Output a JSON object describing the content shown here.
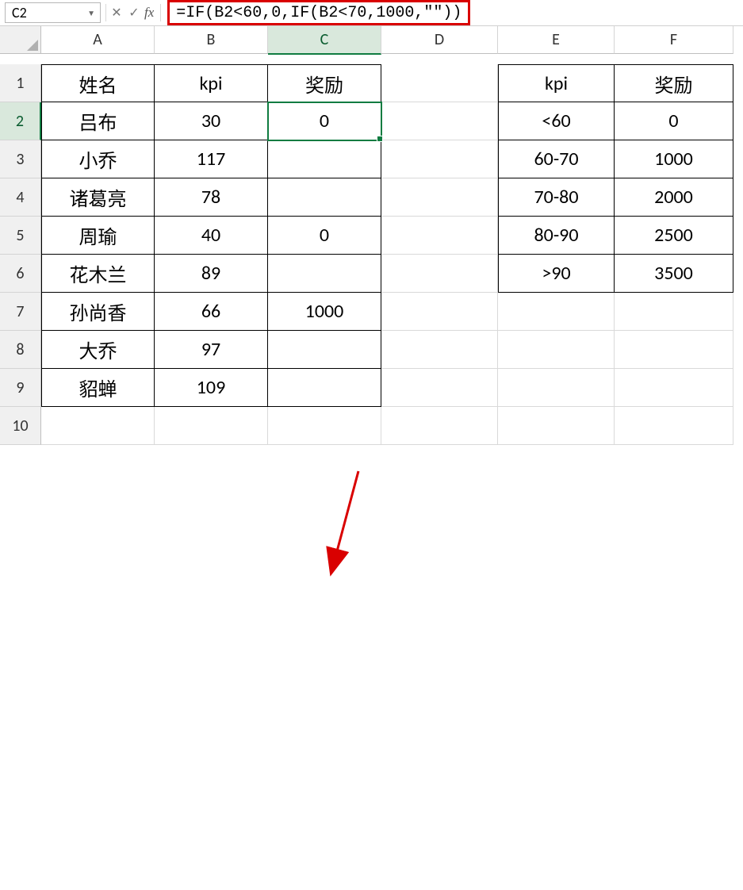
{
  "nameBox": {
    "value": "C2"
  },
  "formulaBar": {
    "cancel": "✕",
    "enter": "✓",
    "fx": "fx",
    "formula": "=IF(B2<60,0,IF(B2<70,1000,\"\"))"
  },
  "colHeaders": [
    "A",
    "B",
    "C",
    "D",
    "E",
    "F"
  ],
  "rowHeaders": [
    "1",
    "2",
    "3",
    "4",
    "5",
    "6",
    "7",
    "8",
    "9",
    "10"
  ],
  "selectedCell": "C2",
  "table_main": {
    "headers": {
      "A": "姓名",
      "B": "kpi",
      "C": "奖励"
    },
    "rows": [
      {
        "A": "吕布",
        "B": "30",
        "C": "0"
      },
      {
        "A": "小乔",
        "B": "117",
        "C": ""
      },
      {
        "A": "诸葛亮",
        "B": "78",
        "C": ""
      },
      {
        "A": "周瑜",
        "B": "40",
        "C": "0"
      },
      {
        "A": "花木兰",
        "B": "89",
        "C": ""
      },
      {
        "A": "孙尚香",
        "B": "66",
        "C": "1000"
      },
      {
        "A": "大乔",
        "B": "97",
        "C": ""
      },
      {
        "A": "貂蝉",
        "B": "109",
        "C": ""
      }
    ]
  },
  "table_ref": {
    "headers": {
      "E": "kpi",
      "F": "奖励"
    },
    "rows": [
      {
        "E": "<60",
        "F": "0"
      },
      {
        "E": "60-70",
        "F": "1000"
      },
      {
        "E": "70-80",
        "F": "2000"
      },
      {
        "E": "80-90",
        "F": "2500"
      },
      {
        "E": ">90",
        "F": "3500"
      }
    ]
  }
}
